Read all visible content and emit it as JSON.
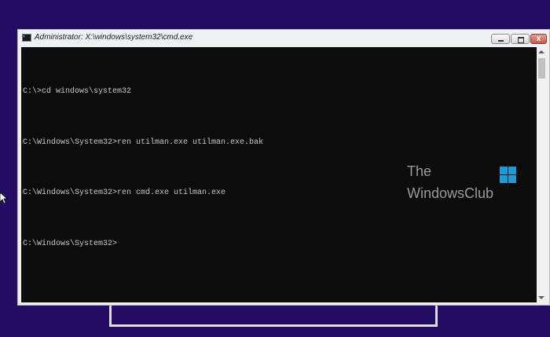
{
  "window": {
    "title": "Administrator: X:\\windows\\system32\\cmd.exe",
    "close_glyph": "x"
  },
  "console": {
    "lines": [
      "C:\\>cd windows\\system32",
      "C:\\Windows\\System32>ren utilman.exe utilman.exe.bak",
      "C:\\Windows\\System32>ren cmd.exe utilman.exe",
      "C:\\Windows\\System32>"
    ]
  },
  "watermark": {
    "line1": "The",
    "line2": "WindowsClub"
  },
  "icons": {
    "app": "cmd-icon",
    "logo": "windows-logo-icon",
    "pointer": "mouse-pointer-icon"
  },
  "colors": {
    "desktop": "#240c64",
    "console_bg": "#0c0c0c",
    "console_text": "#c8c8c8",
    "logo": "#1e9bd7"
  }
}
